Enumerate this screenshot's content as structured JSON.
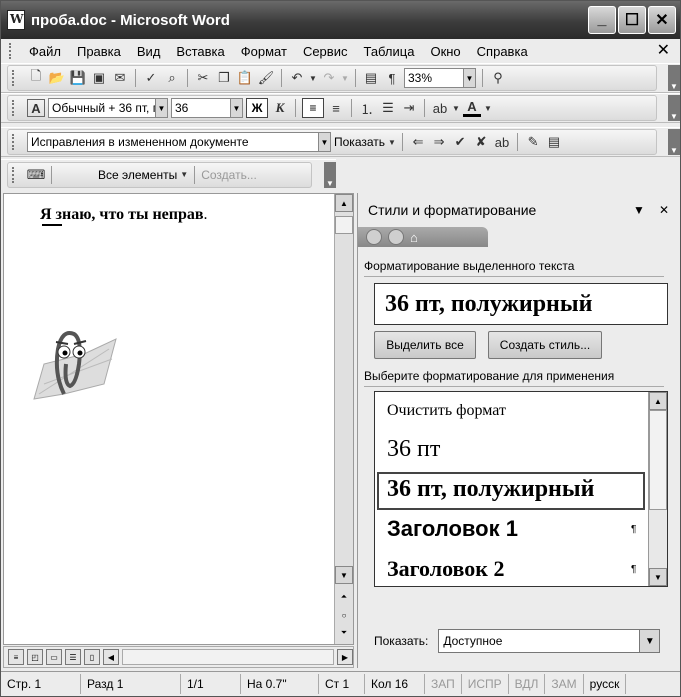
{
  "window": {
    "title": "проба.doc - Microsoft Word",
    "min": "_",
    "max": "☐",
    "close": "✕"
  },
  "menu": [
    "Файл",
    "Правка",
    "Вид",
    "Вставка",
    "Формат",
    "Сервис",
    "Таблица",
    "Окно",
    "Справка"
  ],
  "menu_close": "✕",
  "std_toolbar": {
    "zoom": "33%"
  },
  "fmt_toolbar": {
    "style": "Обычный + 36 пт, г",
    "size": "36",
    "bold": "Ж",
    "italic": "К",
    "font_color_letter": "A"
  },
  "review_toolbar": {
    "mode": "Исправления в измененном документе",
    "show": "Показать"
  },
  "org_toolbar": {
    "all": "Все элементы",
    "create": "Создать..."
  },
  "document": {
    "text": "Я знаю, что ты неправ",
    "end_dot": "."
  },
  "taskpane": {
    "title": "Стили и форматирование",
    "selected_label": "Форматирование выделенного текста",
    "selected_value": "36 пт, полужирный",
    "btn_select_all": "Выделить все",
    "btn_create_style": "Создать стиль...",
    "apply_label": "Выберите форматирование для применения",
    "items": [
      "Очистить формат",
      "36 пт",
      "36 пт, полужирный",
      "Заголовок 1",
      "Заголовок 2"
    ],
    "para_mark": "¶",
    "show_label": "Показать:",
    "show_value": "Доступное"
  },
  "status": {
    "page": "Стр. 1",
    "section": "Разд 1",
    "pages": "1/1",
    "at": "На 0.7\"",
    "line": "Ст 1",
    "col": "Кол 16",
    "rec": "ЗАП",
    "trk": "ИСПР",
    "ext": "ВДЛ",
    "ovr": "ЗАМ",
    "lang": "русск"
  }
}
